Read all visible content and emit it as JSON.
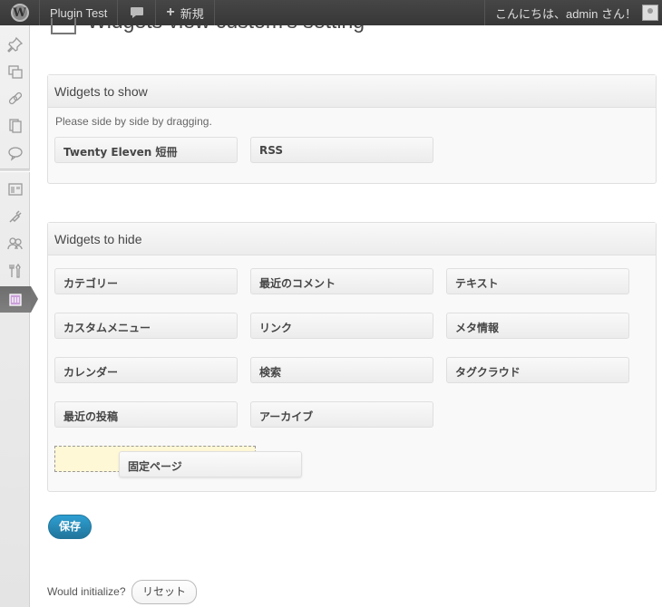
{
  "adminbar": {
    "site_name": "Plugin Test",
    "new_label": "新規",
    "greeting": "こんにちは、admin さん！"
  },
  "sidebar": {
    "icons": [
      "pin-icon",
      "media-icon",
      "links-icon",
      "pages-icon",
      "comments-icon",
      "appearance-icon",
      "plugins-icon",
      "users-icon",
      "tools-icon",
      "settings-icon"
    ],
    "active": "settings-icon"
  },
  "page": {
    "title": "Widgets view custom's setting"
  },
  "show_panel": {
    "title": "Widgets to show",
    "hint": "Please side by side by dragging.",
    "widgets": [
      "Twenty Eleven 短冊",
      "RSS"
    ]
  },
  "hide_panel": {
    "title": "Widgets to hide",
    "widgets": [
      "カテゴリー",
      "最近のコメント",
      "テキスト",
      "カスタムメニュー",
      "リンク",
      "メタ情報",
      "カレンダー",
      "検索",
      "タグクラウド",
      "最近の投稿",
      "アーカイブ"
    ],
    "dragging_widget": "固定ページ"
  },
  "actions": {
    "save_label": "保存",
    "initialize_label": "Would initialize?",
    "reset_label": "リセット"
  },
  "colors": {
    "adminbar_bg": "#464646",
    "save_button": "#21759b",
    "drop_placeholder": "#fff8d6"
  }
}
